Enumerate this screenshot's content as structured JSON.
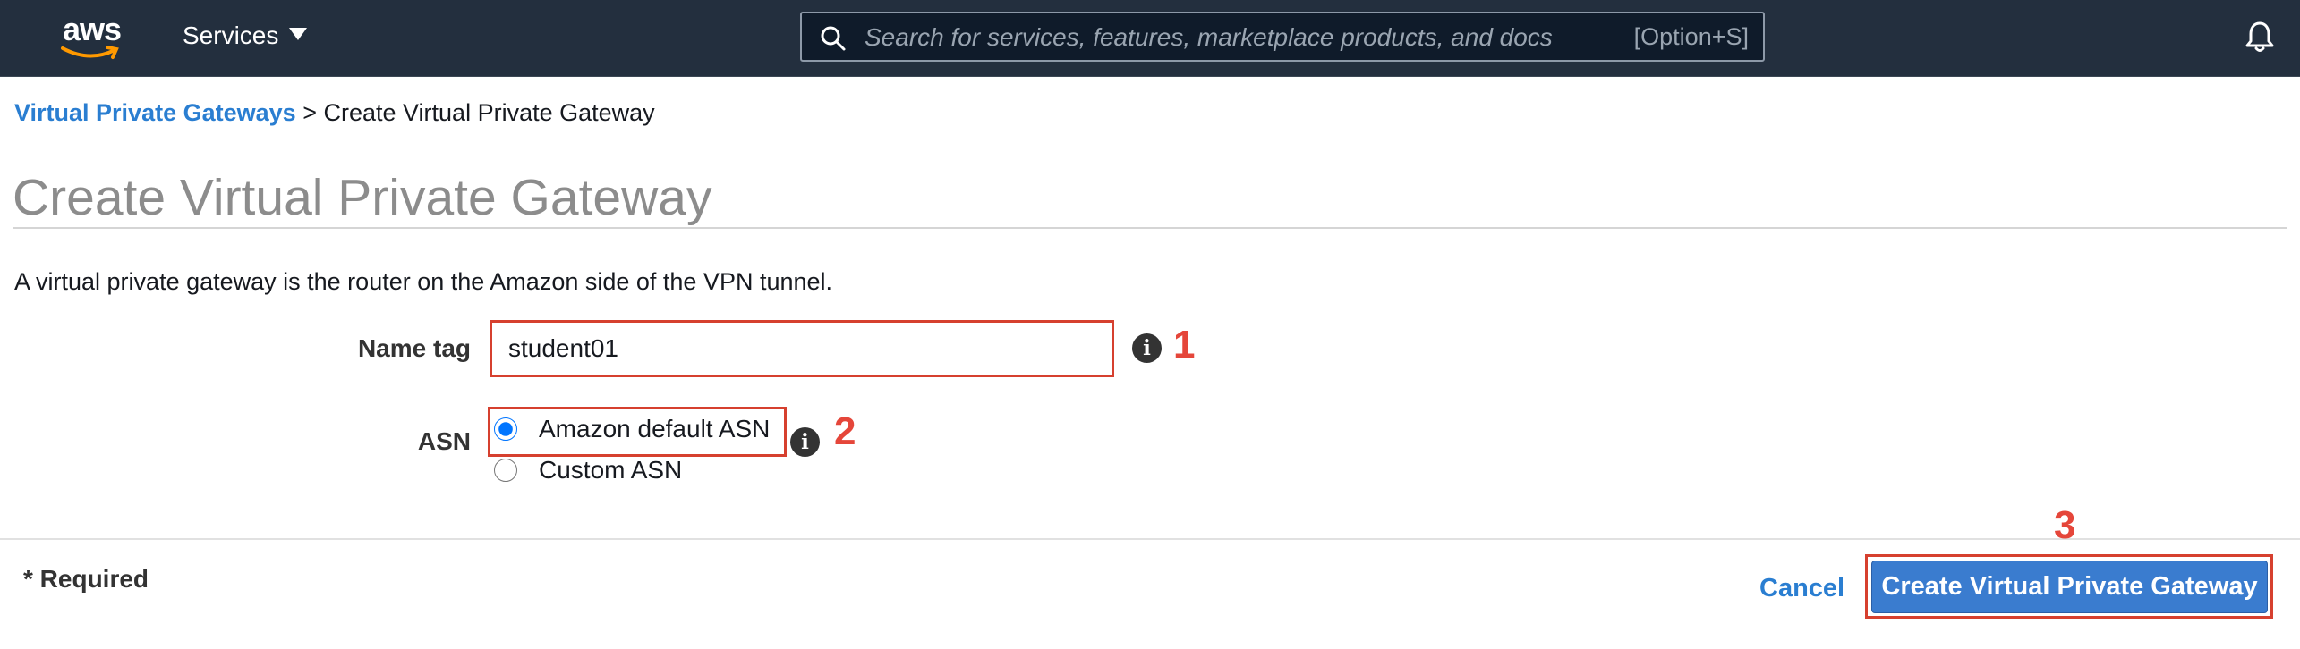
{
  "nav": {
    "logo_text": "aws",
    "services_label": "Services",
    "search_placeholder": "Search for services, features, marketplace products, and docs",
    "search_shortcut": "[Option+S]"
  },
  "breadcrumb": {
    "parent": "Virtual Private Gateways",
    "separator": ">",
    "current": "Create Virtual Private Gateway"
  },
  "page": {
    "title": "Create Virtual Private Gateway",
    "description": "A virtual private gateway is the router on the Amazon side of the VPN tunnel."
  },
  "form": {
    "name_label": "Name tag",
    "name_value": "student01",
    "asn_label": "ASN",
    "asn_options": [
      {
        "label": "Amazon default ASN",
        "selected": true
      },
      {
        "label": "Custom ASN",
        "selected": false
      }
    ]
  },
  "annotations": {
    "step1": "1",
    "step2": "2",
    "step3": "3"
  },
  "footer": {
    "required_text": "* Required",
    "cancel_label": "Cancel",
    "create_label": "Create Virtual Private Gateway"
  },
  "colors": {
    "nav_bg": "#232f3e",
    "link": "#2a7ed1",
    "primary_button": "#3a7ccf",
    "annotation": "#e5463a"
  }
}
